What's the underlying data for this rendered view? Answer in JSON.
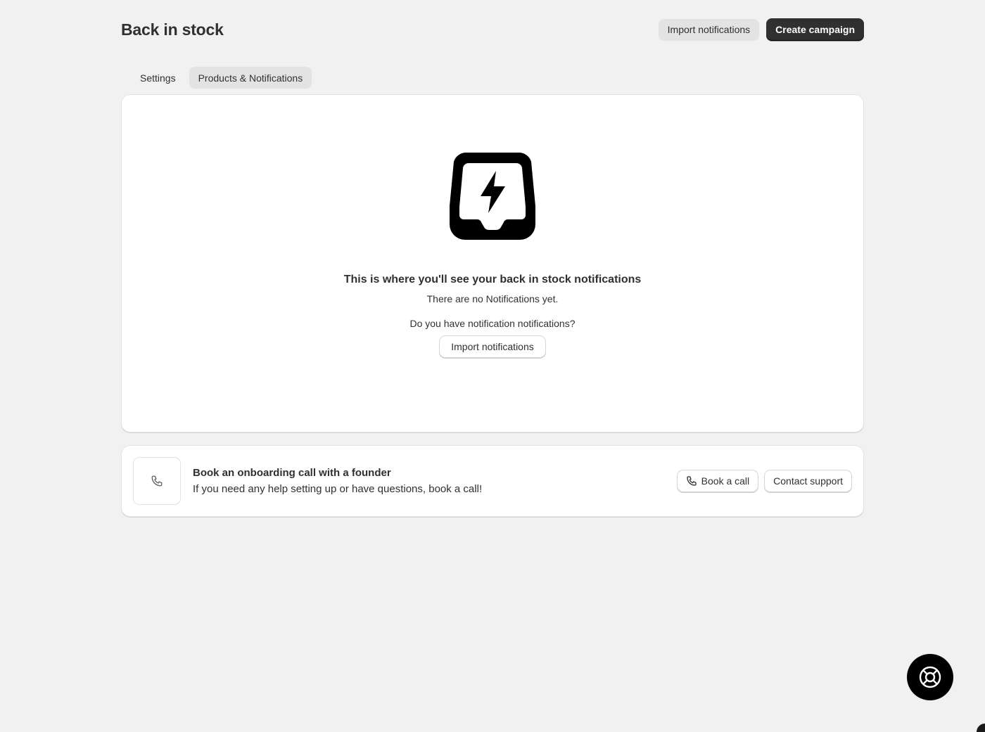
{
  "header": {
    "title": "Back in stock",
    "import_label": "Import notifications",
    "create_label": "Create campaign"
  },
  "tabs": [
    {
      "label": "Settings",
      "active": false
    },
    {
      "label": "Products & Notifications",
      "active": true
    }
  ],
  "empty_state": {
    "icon": "inbox-lightning-icon",
    "heading": "This is where you'll see your back in stock notifications",
    "subtext": "There are no Notifications yet.",
    "question": "Do you have notification notifications?",
    "import_label": "Import notifications"
  },
  "onboarding": {
    "icon": "phone-icon",
    "title": "Book an onboarding call with a founder",
    "description": "If you need any help setting up or have questions, book a call!",
    "book_label": "Book a call",
    "support_label": "Contact support"
  },
  "help_button": {
    "icon": "lifebuoy-icon"
  },
  "colors": {
    "background": "#f1f1f1",
    "card": "#ffffff",
    "primary_button": "#303030",
    "help_button": "#000000"
  }
}
